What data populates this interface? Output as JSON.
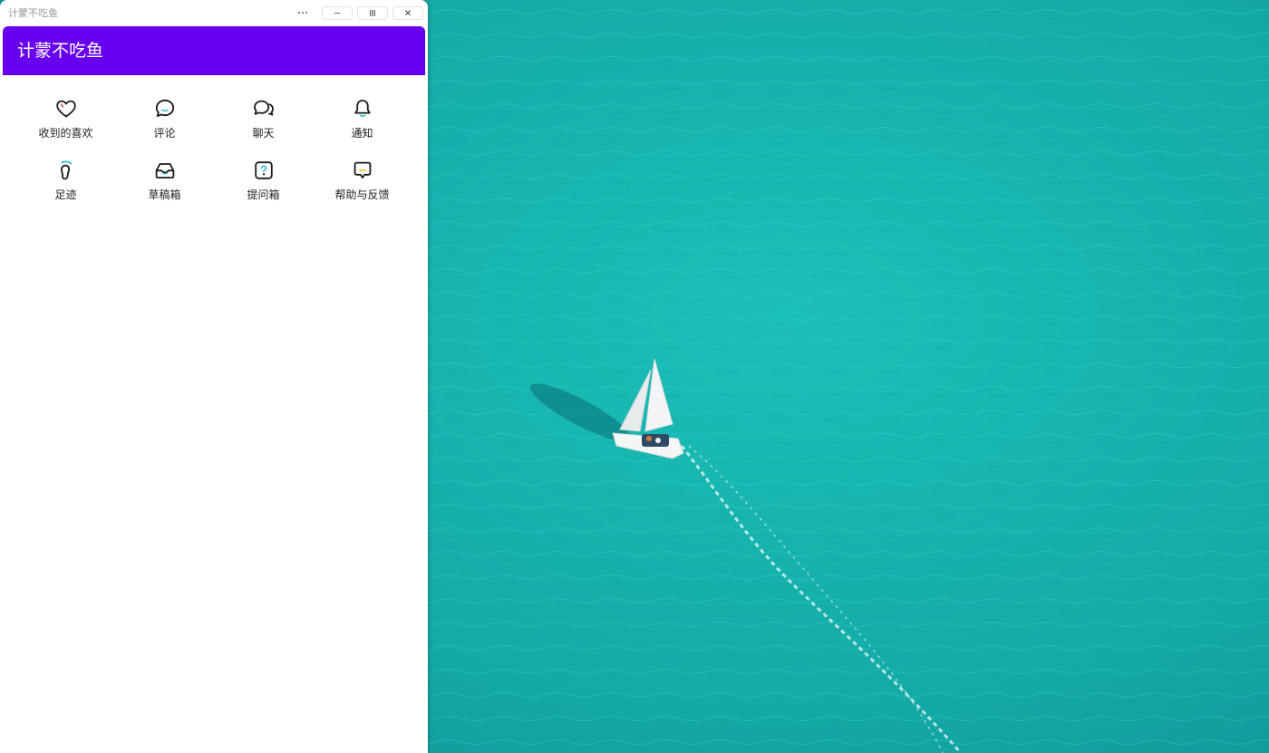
{
  "window": {
    "title": "计蒙不吃鱼"
  },
  "header": {
    "title": "计蒙不吃鱼"
  },
  "menu_items": [
    {
      "label": "收到的喜欢",
      "icon": "heart-icon"
    },
    {
      "label": "评论",
      "icon": "comment-bubble-icon"
    },
    {
      "label": "聊天",
      "icon": "chat-bubbles-icon"
    },
    {
      "label": "通知",
      "icon": "bell-icon"
    },
    {
      "label": "足迹",
      "icon": "footprint-icon"
    },
    {
      "label": "草稿箱",
      "icon": "inbox-tray-icon"
    },
    {
      "label": "提问箱",
      "icon": "question-box-icon"
    },
    {
      "label": "帮助与反馈",
      "icon": "feedback-message-icon"
    }
  ],
  "colors": {
    "header_bg": "#6600ee",
    "wallpaper_sea": "#17b3ad",
    "icon_accent_teal": "#35c3c9",
    "icon_accent_red": "#e04b4b",
    "icon_accent_yellow": "#f2c230"
  },
  "wallpaper": {
    "subject": "sailboat-on-sea-image"
  }
}
